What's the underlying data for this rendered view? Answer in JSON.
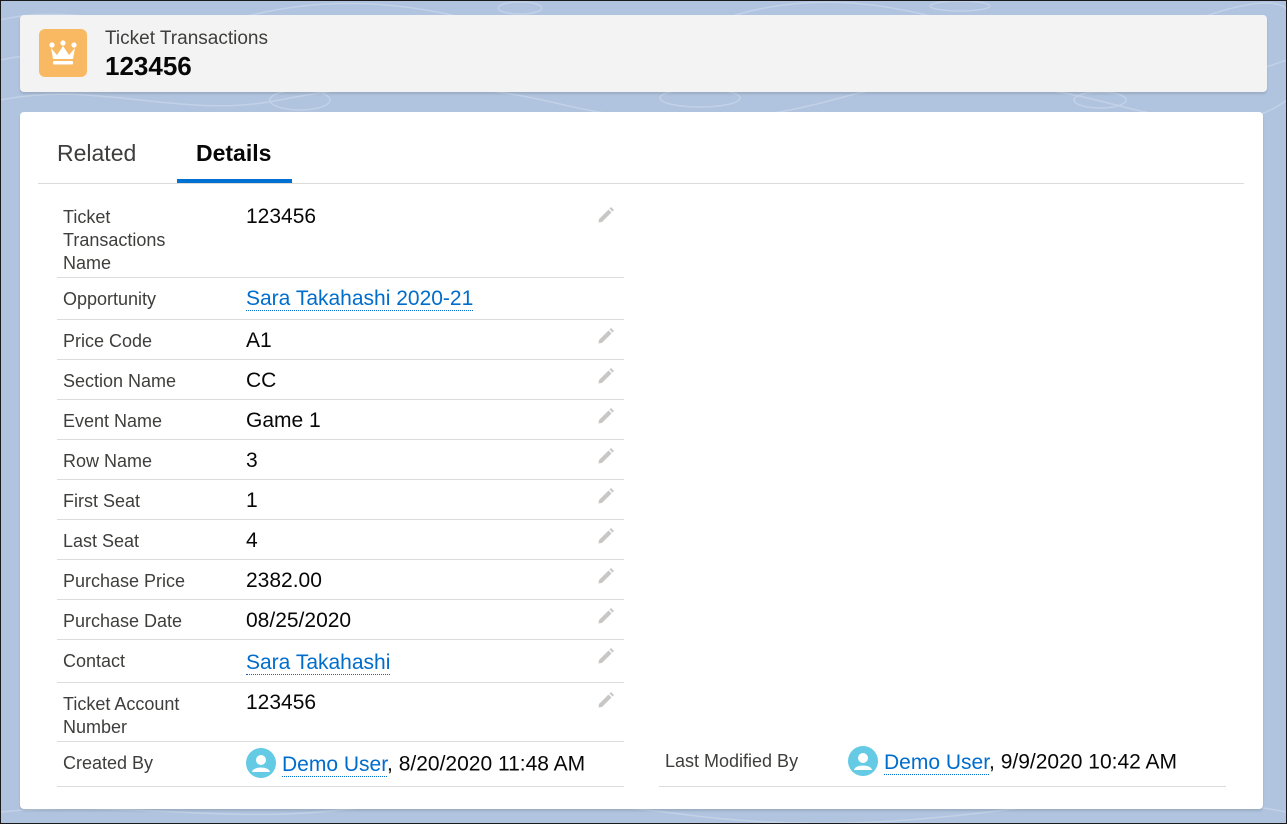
{
  "header": {
    "object_label": "Ticket Transactions",
    "record_name": "123456",
    "icon": "crown-icon"
  },
  "tabs": [
    {
      "label": "Related",
      "active": false
    },
    {
      "label": "Details",
      "active": true
    }
  ],
  "fields": {
    "name": {
      "label": "Ticket Transactions Name",
      "value": "123456",
      "editable": true
    },
    "opportunity": {
      "label": "Opportunity",
      "value": "Sara Takahashi 2020-21",
      "editable": false
    },
    "price_code": {
      "label": "Price Code",
      "value": "A1",
      "editable": true
    },
    "section_name": {
      "label": "Section Name",
      "value": "CC",
      "editable": true
    },
    "event_name": {
      "label": "Event Name",
      "value": "Game 1",
      "editable": true
    },
    "row_name": {
      "label": "Row Name",
      "value": "3",
      "editable": true
    },
    "first_seat": {
      "label": "First Seat",
      "value": "1",
      "editable": true
    },
    "last_seat": {
      "label": "Last Seat",
      "value": "4",
      "editable": true
    },
    "purchase_price": {
      "label": "Purchase Price",
      "value": "2382.00",
      "editable": true
    },
    "purchase_date": {
      "label": "Purchase Date",
      "value": "08/25/2020",
      "editable": true
    },
    "contact": {
      "label": "Contact",
      "value": "Sara Takahashi",
      "editable": true
    },
    "ticket_account_number": {
      "label": "Ticket Account Number",
      "value": "123456",
      "editable": true
    }
  },
  "audit": {
    "created_by": {
      "label": "Created By",
      "user": "Demo User",
      "timestamp": ", 8/20/2020 11:48 AM"
    },
    "last_modified_by": {
      "label": "Last Modified By",
      "user": "Demo User",
      "timestamp": ", 9/9/2020 10:42 AM"
    }
  },
  "colors": {
    "background": "#b0c4df",
    "header_icon": "#f9b862",
    "link": "#006dcc",
    "tab_active_underline": "#0070d2",
    "avatar": "#65cae4"
  }
}
